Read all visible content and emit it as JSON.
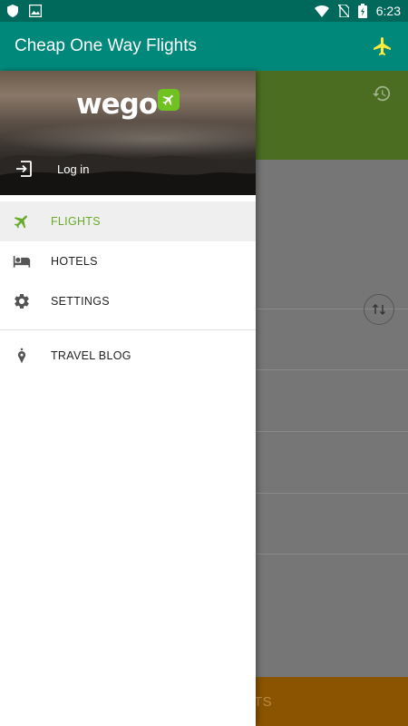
{
  "status_bar": {
    "time": "6:23"
  },
  "app_bar": {
    "title": "Cheap One Way Flights"
  },
  "drawer": {
    "brand": "wego",
    "login_label": "Log in",
    "items": [
      {
        "label": "FLIGHTS",
        "icon": "airplane-icon",
        "active": true
      },
      {
        "label": "HOTELS",
        "icon": "bed-icon",
        "active": false
      },
      {
        "label": "SETTINGS",
        "icon": "gear-icon",
        "active": false
      }
    ],
    "secondary_items": [
      {
        "label": "TRAVEL BLOG",
        "icon": "location-pin-icon"
      }
    ]
  },
  "background": {
    "bottom_button_fragment": "TS"
  },
  "colors": {
    "primary": "#00897b",
    "status_bar": "#00695c",
    "accent_green": "#6fc21f",
    "active_label": "#6aaa2a"
  }
}
